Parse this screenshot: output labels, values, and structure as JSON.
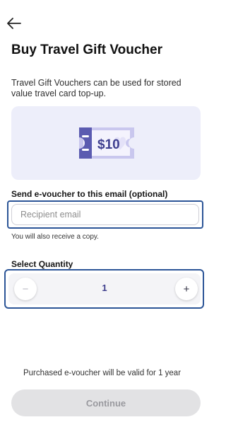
{
  "header": {
    "back_icon": "arrow-left-icon",
    "title": "Buy Travel Gift Voucher"
  },
  "description": "Travel Gift Vouchers can be used for stored value travel card top-up.",
  "voucher": {
    "icon": "voucher-ticket-icon",
    "amount": "$10",
    "colors": {
      "card_bg": "#edeefa",
      "ticket": "#5b5bb0",
      "ticket_light": "#c9c7ee"
    }
  },
  "email_section": {
    "label": "Send e-voucher to this email (optional)",
    "placeholder": "Recipient email",
    "value": "",
    "hint": "You will also receive a copy."
  },
  "quantity_section": {
    "label": "Select Quantity",
    "decrement_symbol": "−",
    "value": "1",
    "increment_symbol": "+"
  },
  "footer": {
    "validity_text": "Purchased e-voucher will be valid for 1 year",
    "continue_label": "Continue"
  },
  "colors": {
    "focus_outline": "#2c5597",
    "accent": "#3d3d8c"
  }
}
